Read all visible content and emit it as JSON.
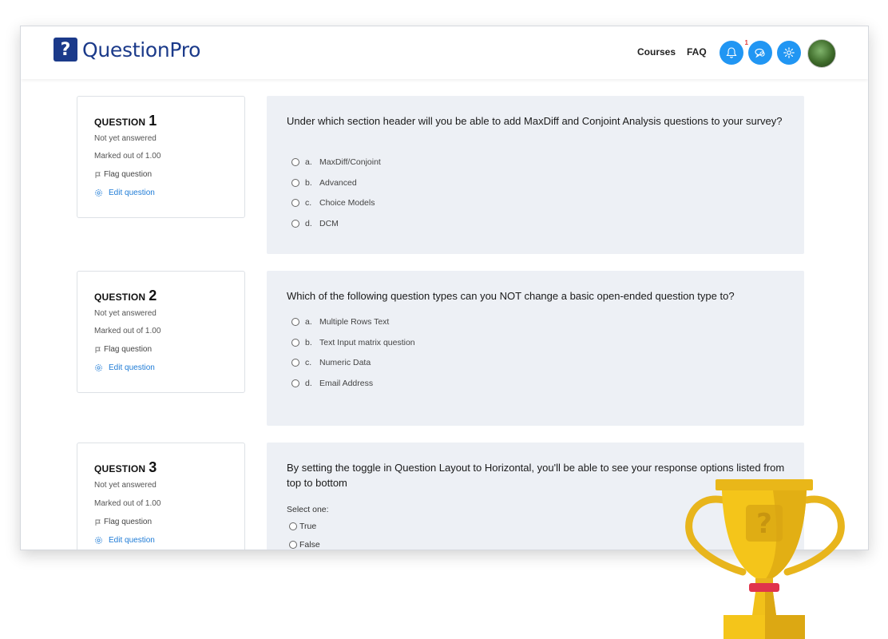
{
  "brand": {
    "logo_glyph": "?",
    "name": "QuestionPro",
    "color": "#1b3a8a"
  },
  "nav": {
    "courses": "Courses",
    "faq": "FAQ",
    "notifications_count": "1",
    "icons": [
      "bell-icon",
      "chat-icon",
      "gear-icon"
    ],
    "accent": "#2196f3"
  },
  "questions": [
    {
      "label": "QUESTION",
      "number": "1",
      "status": "Not yet answered",
      "marked": "Marked out of 1.00",
      "flag": "Flag question",
      "edit": "Edit question",
      "text": "Under which section header will you be able to add MaxDiff and Conjoint Analysis questions to your survey?",
      "options": [
        {
          "letter": "a.",
          "text": "MaxDiff/Conjoint"
        },
        {
          "letter": "b.",
          "text": "Advanced"
        },
        {
          "letter": "c.",
          "text": "Choice Models"
        },
        {
          "letter": "d.",
          "text": "DCM"
        }
      ]
    },
    {
      "label": "QUESTION",
      "number": "2",
      "status": "Not yet answered",
      "marked": "Marked out of 1.00",
      "flag": "Flag question",
      "edit": "Edit question",
      "text": "Which of the following question types can you NOT change a basic open-ended question type to?",
      "options": [
        {
          "letter": "a.",
          "text": "Multiple Rows Text"
        },
        {
          "letter": "b.",
          "text": "Text Input matrix question"
        },
        {
          "letter": "c.",
          "text": "Numeric Data"
        },
        {
          "letter": "d.",
          "text": "Email Address"
        }
      ]
    },
    {
      "label": "QUESTION",
      "number": "3",
      "status": "Not yet answered",
      "marked": "Marked out of 1.00",
      "flag": "Flag question",
      "edit": "Edit question",
      "text": "By setting the toggle in Question Layout to Horizontal, you'll be able to see your response options listed from top to bottom",
      "select_label": "Select one:",
      "options": [
        {
          "text": "True"
        },
        {
          "text": "False"
        }
      ]
    }
  ],
  "trophy": {
    "glyph": "?",
    "color": "#f2c318"
  }
}
